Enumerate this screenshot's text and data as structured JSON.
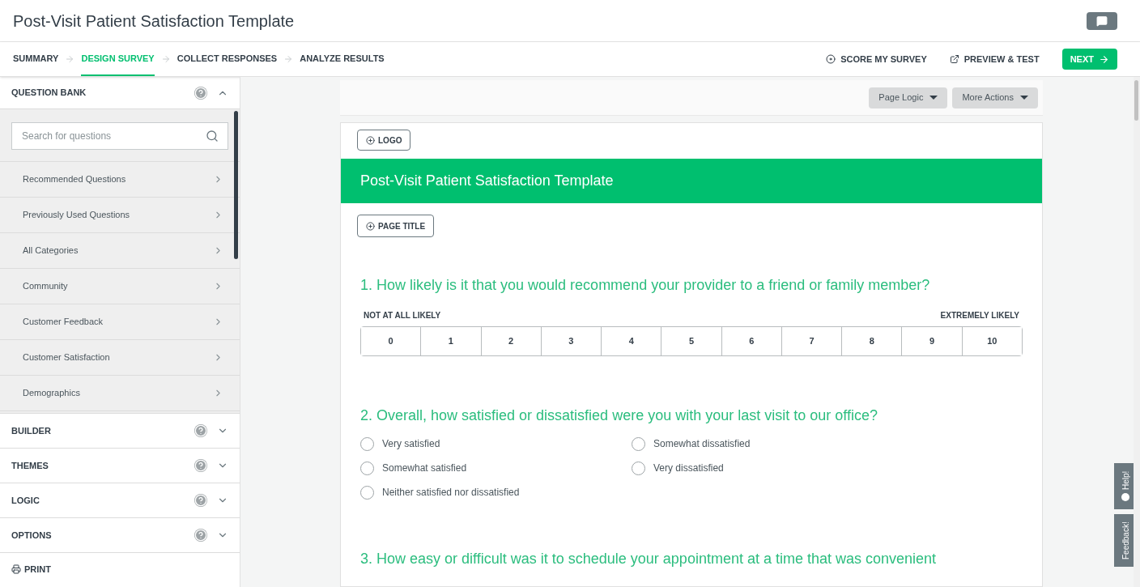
{
  "header": {
    "title": "Post-Visit Patient Satisfaction Template"
  },
  "steps": [
    {
      "label": "SUMMARY",
      "selected": false
    },
    {
      "label": "DESIGN SURVEY",
      "selected": true
    },
    {
      "label": "COLLECT RESPONSES",
      "selected": false
    },
    {
      "label": "ANALYZE RESULTS",
      "selected": false
    }
  ],
  "actions": {
    "score": "SCORE MY SURVEY",
    "preview": "PREVIEW & TEST",
    "next": "NEXT"
  },
  "sidebar": {
    "question_bank": {
      "title": "QUESTION BANK",
      "expanded": true,
      "search_placeholder": "Search for questions",
      "items": [
        "Recommended Questions",
        "Previously Used Questions",
        "All Categories",
        "Community",
        "Customer Feedback",
        "Customer Satisfaction",
        "Demographics"
      ]
    },
    "sections": [
      {
        "title": "BUILDER",
        "expanded": false
      },
      {
        "title": "THEMES",
        "expanded": false
      },
      {
        "title": "LOGIC",
        "expanded": false
      },
      {
        "title": "OPTIONS",
        "expanded": false
      }
    ],
    "print": "PRINT"
  },
  "toolbar": [
    "Page Logic",
    "More Actions"
  ],
  "survey": {
    "logo_button": "LOGO",
    "title": "Post-Visit Patient Satisfaction Template",
    "page_title_button": "PAGE TITLE",
    "questions": [
      {
        "kind": "scale",
        "text": "1. How likely is it that you would recommend your provider to a friend or family member?",
        "low_label": "NOT AT ALL LIKELY",
        "high_label": "EXTREMELY LIKELY",
        "options": [
          {
            "label": "0",
            "selected": false
          },
          {
            "label": "1",
            "selected": false
          },
          {
            "label": "2",
            "selected": false
          },
          {
            "label": "3",
            "selected": false
          },
          {
            "label": "4",
            "selected": false
          },
          {
            "label": "5",
            "selected": false
          },
          {
            "label": "6",
            "selected": false
          },
          {
            "label": "7",
            "selected": false
          },
          {
            "label": "8",
            "selected": false
          },
          {
            "label": "9",
            "selected": false
          },
          {
            "label": "10",
            "selected": false
          }
        ]
      },
      {
        "kind": "choice",
        "text": "2. Overall, how satisfied or dissatisfied were you with your last visit to our office?",
        "options": [
          {
            "label": "Very satisfied",
            "selected": false
          },
          {
            "label": "Somewhat satisfied",
            "selected": false
          },
          {
            "label": "Neither satisfied nor dissatisfied",
            "selected": false
          },
          {
            "label": "Somewhat dissatisfied",
            "selected": false
          },
          {
            "label": "Very dissatisfied",
            "selected": false
          }
        ]
      },
      {
        "kind": "text",
        "text": "3. How easy or difficult was it to schedule your appointment at a time that was convenient"
      }
    ]
  },
  "side_tabs": [
    "Help!",
    "Feedback!"
  ]
}
